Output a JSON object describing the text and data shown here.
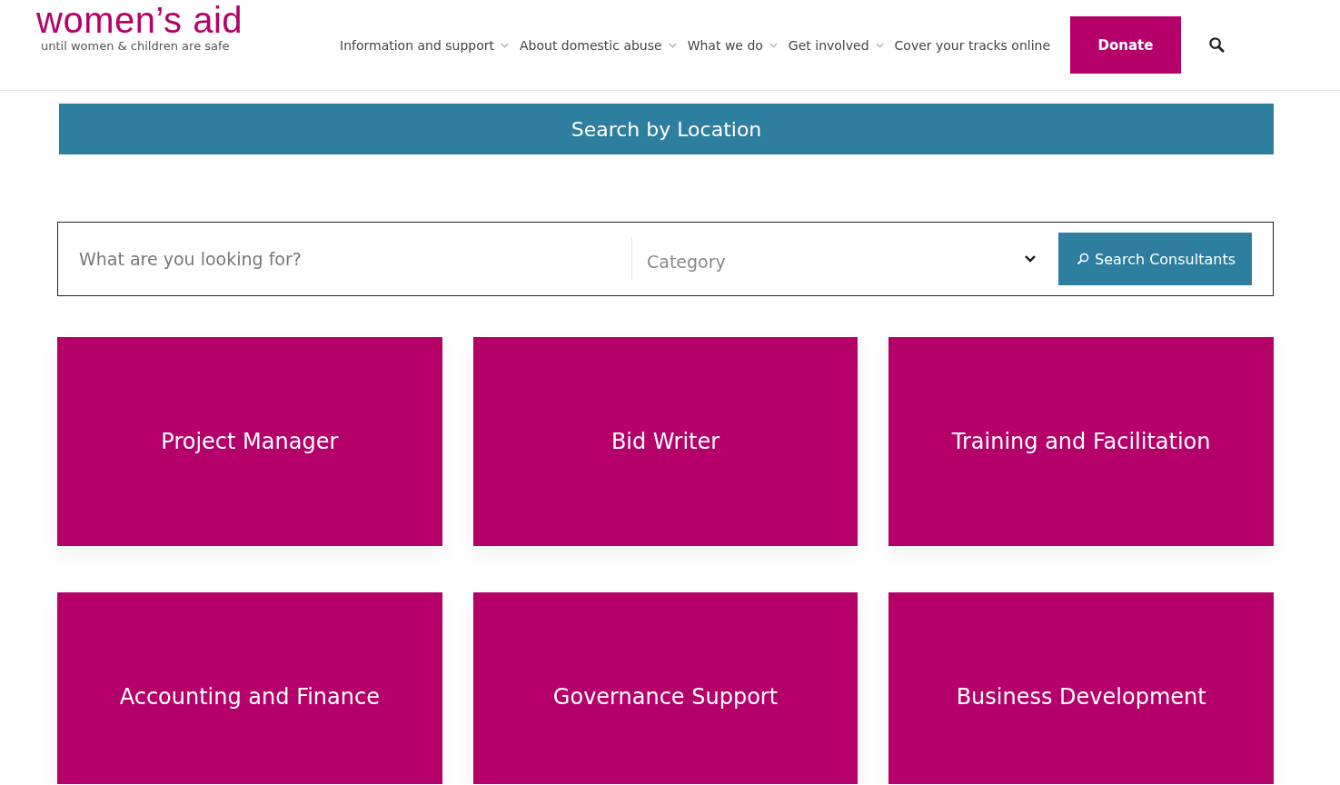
{
  "logo": {
    "name": "women’s aid",
    "tagline": "until women & children are safe"
  },
  "nav": [
    {
      "label": "Information and support",
      "has_menu": true
    },
    {
      "label": "About domestic abuse",
      "has_menu": true
    },
    {
      "label": "What we do",
      "has_menu": true
    },
    {
      "label": "Get involved",
      "has_menu": true
    },
    {
      "label": "Cover your tracks online",
      "has_menu": false
    }
  ],
  "donate": "Donate",
  "banner": "Search by Location",
  "search": {
    "placeholder": "What are you looking for?",
    "category_placeholder": "Category",
    "button": "Search Consultants"
  },
  "cards": [
    {
      "title": "Project Manager"
    },
    {
      "title": "Bid Writer"
    },
    {
      "title": "Training and Facilitation"
    },
    {
      "title": "Accounting and Finance"
    },
    {
      "title": "Governance Support"
    },
    {
      "title": "Business Development"
    }
  ]
}
